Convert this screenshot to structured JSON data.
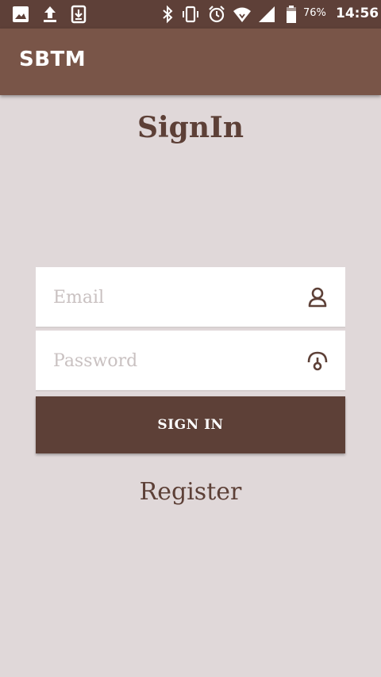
{
  "status_bar": {
    "battery_percent": "76%",
    "time": "14:56",
    "icons": [
      "image-icon",
      "upload-icon",
      "download-icon",
      "bluetooth-icon",
      "vibrate-icon",
      "alarm-icon",
      "wifi-icon",
      "signal-icon",
      "battery-icon"
    ]
  },
  "app_bar": {
    "title": "SBTM"
  },
  "page": {
    "title": "SignIn"
  },
  "form": {
    "email_placeholder": "Email",
    "email_value": "",
    "password_placeholder": "Password",
    "password_value": "",
    "signin_label": "SIGN IN",
    "register_label": "Register"
  },
  "colors": {
    "status_bar": "#5e4038",
    "app_bar": "#795548",
    "accent": "#5d4037",
    "background": "#e0d8d9",
    "placeholder": "#c9c1c1"
  }
}
